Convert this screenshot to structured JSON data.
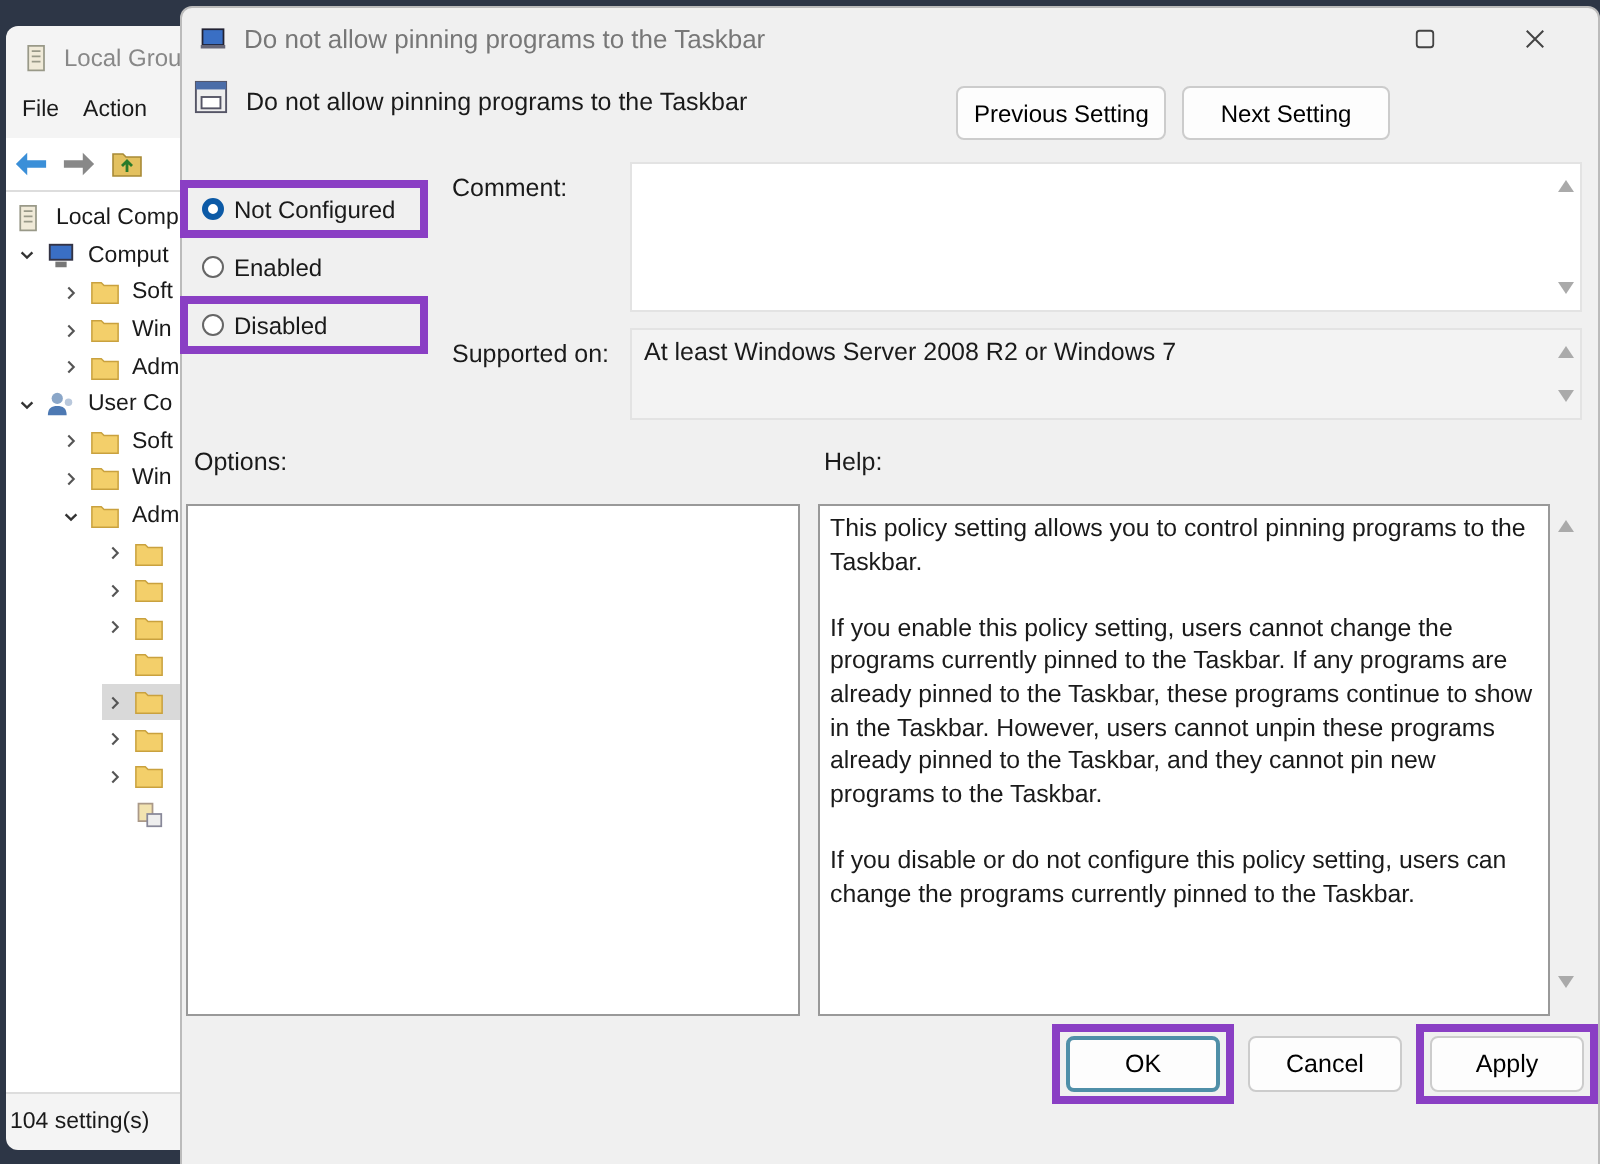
{
  "back_window": {
    "title": "Local Grou",
    "menu": [
      "File",
      "Action"
    ],
    "tree": [
      {
        "label": "Local Comp",
        "kind": "doc",
        "children": [
          {
            "label": "Comput",
            "kind": "computer",
            "expanded": true,
            "children": [
              {
                "label": "Soft",
                "kind": "folder",
                "expanded": false
              },
              {
                "label": "Win",
                "kind": "folder",
                "expanded": false
              },
              {
                "label": "Adm",
                "kind": "folder",
                "expanded": false
              }
            ]
          },
          {
            "label": "User Co",
            "kind": "user",
            "expanded": true,
            "children": [
              {
                "label": "Soft",
                "kind": "folder",
                "expanded": false
              },
              {
                "label": "Win",
                "kind": "folder",
                "expanded": false
              },
              {
                "label": "Adm",
                "kind": "folder",
                "expanded": true,
                "children": [
                  {
                    "kind": "folder",
                    "expanded": false,
                    "selected": false
                  },
                  {
                    "kind": "folder",
                    "expanded": false,
                    "selected": false
                  },
                  {
                    "kind": "folder",
                    "expanded": false,
                    "selected": false
                  },
                  {
                    "kind": "folder",
                    "selected": false
                  },
                  {
                    "kind": "folder",
                    "expanded": false,
                    "selected": true
                  },
                  {
                    "kind": "folder",
                    "expanded": false,
                    "selected": false
                  },
                  {
                    "kind": "folder",
                    "expanded": false,
                    "selected": false
                  },
                  {
                    "kind": "settings",
                    "selected": false
                  }
                ]
              }
            ]
          }
        ]
      }
    ],
    "status_bar": "104 setting(s)"
  },
  "dialog": {
    "title": "Do not allow pinning programs to the Taskbar",
    "heading": "Do not allow pinning programs to the Taskbar",
    "nav_buttons": [
      "Previous Setting",
      "Next Setting"
    ],
    "options": [
      {
        "label": "Not Configured",
        "selected": true,
        "highlighted": true
      },
      {
        "label": "Enabled",
        "selected": false,
        "highlighted": false
      },
      {
        "label": "Disabled",
        "selected": false,
        "highlighted": true
      }
    ],
    "comment_label": "Comment:",
    "supported_label": "Supported on:",
    "supported_value": "At least Windows Server 2008 R2 or Windows 7",
    "options_label": "Options:",
    "help_label": "Help:",
    "help": [
      "This policy setting allows you to control pinning programs to the Taskbar.",
      "If you enable this policy setting, users cannot change the programs currently pinned to the Taskbar. If any programs are already pinned to the Taskbar, these programs continue to show in the Taskbar. However, users cannot unpin these programs already pinned to the Taskbar, and they cannot pin new programs to the Taskbar.",
      "If you disable or do not configure this policy setting, users can change the programs currently pinned to the Taskbar."
    ],
    "buttons": [
      {
        "label": "OK",
        "default": true,
        "highlighted": true
      },
      {
        "label": "Cancel",
        "default": false,
        "highlighted": false
      },
      {
        "label": "Apply",
        "default": false,
        "highlighted": true
      }
    ]
  }
}
